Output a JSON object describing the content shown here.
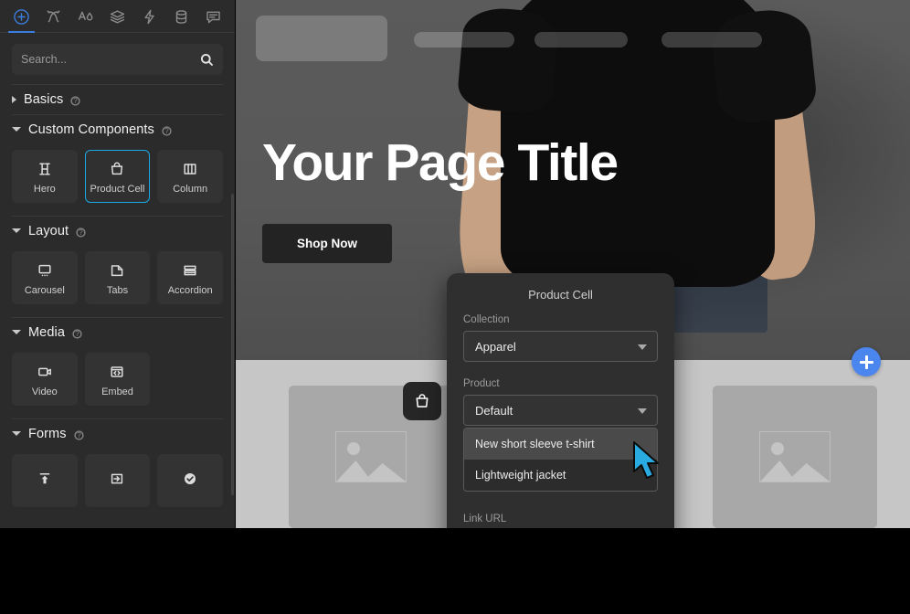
{
  "toolbar": {
    "items": [
      {
        "name": "add-icon",
        "label": "Add",
        "active": true
      },
      {
        "name": "effects-icon",
        "label": "Effects",
        "active": false
      },
      {
        "name": "typography-color-icon",
        "label": "Typography",
        "active": false
      },
      {
        "name": "layers-icon",
        "label": "Layers",
        "active": false
      },
      {
        "name": "interactions-icon",
        "label": "Interactions",
        "active": false
      },
      {
        "name": "data-icon",
        "label": "Data",
        "active": false
      },
      {
        "name": "comments-icon",
        "label": "Comments",
        "active": false
      }
    ]
  },
  "search": {
    "placeholder": "Search...",
    "value": ""
  },
  "sections": [
    {
      "title": "Basics",
      "open": false,
      "tiles": []
    },
    {
      "title": "Custom Components",
      "open": true,
      "tiles": [
        {
          "label": "Hero",
          "icon": "heading-icon",
          "selected": false
        },
        {
          "label": "Product Cell",
          "icon": "shopping-bag-icon",
          "selected": true
        },
        {
          "label": "Column",
          "icon": "columns-icon",
          "selected": false
        }
      ]
    },
    {
      "title": "Layout",
      "open": true,
      "tiles": [
        {
          "label": "Carousel",
          "icon": "carousel-icon",
          "selected": false
        },
        {
          "label": "Tabs",
          "icon": "tabs-icon",
          "selected": false
        },
        {
          "label": "Accordion",
          "icon": "accordion-icon",
          "selected": false
        }
      ]
    },
    {
      "title": "Media",
      "open": true,
      "tiles": [
        {
          "label": "Video",
          "icon": "video-icon",
          "selected": false
        },
        {
          "label": "Embed",
          "icon": "embed-code-icon",
          "selected": false
        }
      ]
    },
    {
      "title": "Forms",
      "open": true,
      "tiles": [
        {
          "label": "",
          "icon": "upload-icon",
          "selected": false
        },
        {
          "label": "",
          "icon": "input-field-icon",
          "selected": false
        },
        {
          "label": "",
          "icon": "checkbox-checked-icon",
          "selected": false
        }
      ]
    }
  ],
  "canvas": {
    "hero_title": "Your Page Title",
    "shop_button": "Shop Now",
    "add_block_button": "+"
  },
  "dialog": {
    "title": "Product Cell",
    "collection_label": "Collection",
    "collection_value": "Apparel",
    "product_label": "Product",
    "product_value": "Default",
    "product_options": [
      {
        "label": "New short sleeve t-shirt",
        "highlighted": true
      },
      {
        "label": "Lightweight jacket",
        "highlighted": false
      }
    ],
    "link_label": "Link URL",
    "link_value": "",
    "link_placeholder": ""
  },
  "colors": {
    "accent_blue": "#19a9e5",
    "tool_active": "#3b7ddd",
    "fab_blue": "#4a86ed",
    "sidebar_bg": "#2b2b2b",
    "tile_bg": "#333333",
    "dialog_bg": "#2f2f2f",
    "canvas_bg": "#c6c6c6"
  }
}
